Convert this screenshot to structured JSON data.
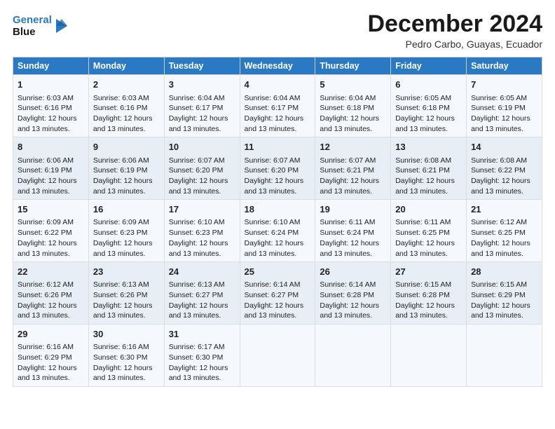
{
  "logo": {
    "line1": "General",
    "line2": "Blue"
  },
  "title": "December 2024",
  "subtitle": "Pedro Carbo, Guayas, Ecuador",
  "headers": [
    "Sunday",
    "Monday",
    "Tuesday",
    "Wednesday",
    "Thursday",
    "Friday",
    "Saturday"
  ],
  "weeks": [
    [
      {
        "day": "1",
        "rise": "6:03 AM",
        "set": "6:16 PM",
        "daylight": "12 hours and 13 minutes."
      },
      {
        "day": "2",
        "rise": "6:03 AM",
        "set": "6:16 PM",
        "daylight": "12 hours and 13 minutes."
      },
      {
        "day": "3",
        "rise": "6:04 AM",
        "set": "6:17 PM",
        "daylight": "12 hours and 13 minutes."
      },
      {
        "day": "4",
        "rise": "6:04 AM",
        "set": "6:17 PM",
        "daylight": "12 hours and 13 minutes."
      },
      {
        "day": "5",
        "rise": "6:04 AM",
        "set": "6:18 PM",
        "daylight": "12 hours and 13 minutes."
      },
      {
        "day": "6",
        "rise": "6:05 AM",
        "set": "6:18 PM",
        "daylight": "12 hours and 13 minutes."
      },
      {
        "day": "7",
        "rise": "6:05 AM",
        "set": "6:19 PM",
        "daylight": "12 hours and 13 minutes."
      }
    ],
    [
      {
        "day": "8",
        "rise": "6:06 AM",
        "set": "6:19 PM",
        "daylight": "12 hours and 13 minutes."
      },
      {
        "day": "9",
        "rise": "6:06 AM",
        "set": "6:19 PM",
        "daylight": "12 hours and 13 minutes."
      },
      {
        "day": "10",
        "rise": "6:07 AM",
        "set": "6:20 PM",
        "daylight": "12 hours and 13 minutes."
      },
      {
        "day": "11",
        "rise": "6:07 AM",
        "set": "6:20 PM",
        "daylight": "12 hours and 13 minutes."
      },
      {
        "day": "12",
        "rise": "6:07 AM",
        "set": "6:21 PM",
        "daylight": "12 hours and 13 minutes."
      },
      {
        "day": "13",
        "rise": "6:08 AM",
        "set": "6:21 PM",
        "daylight": "12 hours and 13 minutes."
      },
      {
        "day": "14",
        "rise": "6:08 AM",
        "set": "6:22 PM",
        "daylight": "12 hours and 13 minutes."
      }
    ],
    [
      {
        "day": "15",
        "rise": "6:09 AM",
        "set": "6:22 PM",
        "daylight": "12 hours and 13 minutes."
      },
      {
        "day": "16",
        "rise": "6:09 AM",
        "set": "6:23 PM",
        "daylight": "12 hours and 13 minutes."
      },
      {
        "day": "17",
        "rise": "6:10 AM",
        "set": "6:23 PM",
        "daylight": "12 hours and 13 minutes."
      },
      {
        "day": "18",
        "rise": "6:10 AM",
        "set": "6:24 PM",
        "daylight": "12 hours and 13 minutes."
      },
      {
        "day": "19",
        "rise": "6:11 AM",
        "set": "6:24 PM",
        "daylight": "12 hours and 13 minutes."
      },
      {
        "day": "20",
        "rise": "6:11 AM",
        "set": "6:25 PM",
        "daylight": "12 hours and 13 minutes."
      },
      {
        "day": "21",
        "rise": "6:12 AM",
        "set": "6:25 PM",
        "daylight": "12 hours and 13 minutes."
      }
    ],
    [
      {
        "day": "22",
        "rise": "6:12 AM",
        "set": "6:26 PM",
        "daylight": "12 hours and 13 minutes."
      },
      {
        "day": "23",
        "rise": "6:13 AM",
        "set": "6:26 PM",
        "daylight": "12 hours and 13 minutes."
      },
      {
        "day": "24",
        "rise": "6:13 AM",
        "set": "6:27 PM",
        "daylight": "12 hours and 13 minutes."
      },
      {
        "day": "25",
        "rise": "6:14 AM",
        "set": "6:27 PM",
        "daylight": "12 hours and 13 minutes."
      },
      {
        "day": "26",
        "rise": "6:14 AM",
        "set": "6:28 PM",
        "daylight": "12 hours and 13 minutes."
      },
      {
        "day": "27",
        "rise": "6:15 AM",
        "set": "6:28 PM",
        "daylight": "12 hours and 13 minutes."
      },
      {
        "day": "28",
        "rise": "6:15 AM",
        "set": "6:29 PM",
        "daylight": "12 hours and 13 minutes."
      }
    ],
    [
      {
        "day": "29",
        "rise": "6:16 AM",
        "set": "6:29 PM",
        "daylight": "12 hours and 13 minutes."
      },
      {
        "day": "30",
        "rise": "6:16 AM",
        "set": "6:30 PM",
        "daylight": "12 hours and 13 minutes."
      },
      {
        "day": "31",
        "rise": "6:17 AM",
        "set": "6:30 PM",
        "daylight": "12 hours and 13 minutes."
      },
      null,
      null,
      null,
      null
    ]
  ],
  "labels": {
    "sunrise": "Sunrise:",
    "sunset": "Sunset:",
    "daylight": "Daylight:"
  }
}
